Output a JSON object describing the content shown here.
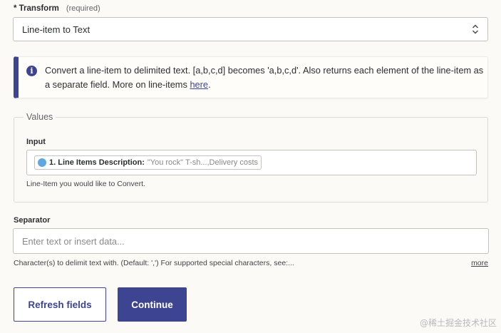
{
  "transform": {
    "label": "* Transform",
    "required_note": "(required)",
    "selected": "Line-item to Text"
  },
  "info": {
    "text": "Convert a line-item to delimited text. [a,b,c,d] becomes 'a,b,c,d'. Also returns each element of the line-item as a separate field. More on line-items ",
    "link_text": "here",
    "suffix": ".",
    "icon": "info-icon"
  },
  "values": {
    "legend": "Values",
    "input_label": "Input",
    "pill_label": "1. Line Items Description:",
    "pill_value": "\"You rock\" T-sh...,Delivery costs",
    "help": "Line-Item you would like to Convert."
  },
  "separator": {
    "label": "Separator",
    "placeholder": "Enter text or insert data...",
    "help": "Character(s) to delimit text with. (Default: ',') For supported special characters, see:...",
    "more": "more"
  },
  "buttons": {
    "refresh": "Refresh fields",
    "continue": "Continue"
  },
  "watermark": "@稀土掘金技术社区",
  "colors": {
    "accent": "#3d4592",
    "background": "#fbfaf7",
    "app_dot": "#5ea7e0"
  }
}
